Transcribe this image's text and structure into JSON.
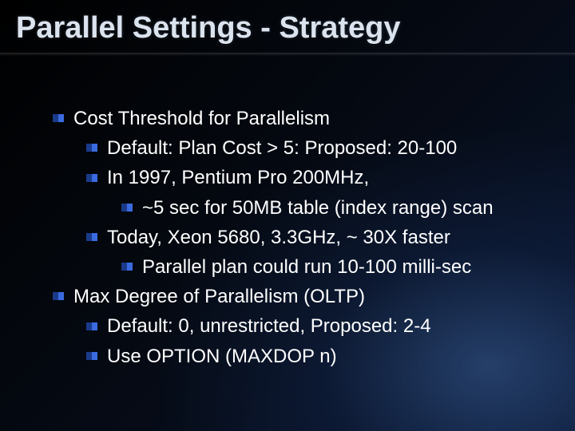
{
  "title": "Parallel Settings - Strategy",
  "lines": {
    "l0": "Cost Threshold for Parallelism",
    "l1": "Default: Plan Cost > 5: Proposed: 20-100",
    "l2": "In 1997, Pentium Pro 200MHz,",
    "l3": "~5 sec for 50MB table (index range) scan",
    "l4": "Today, Xeon 5680, 3.3GHz, ~ 30X faster",
    "l5": "Parallel plan could run 10-100 milli-sec",
    "l6": "Max Degree of Parallelism (OLTP)",
    "l7": "Default: 0, unrestricted, Proposed: 2-4",
    "l8": "Use OPTION (MAXDOP n)"
  }
}
